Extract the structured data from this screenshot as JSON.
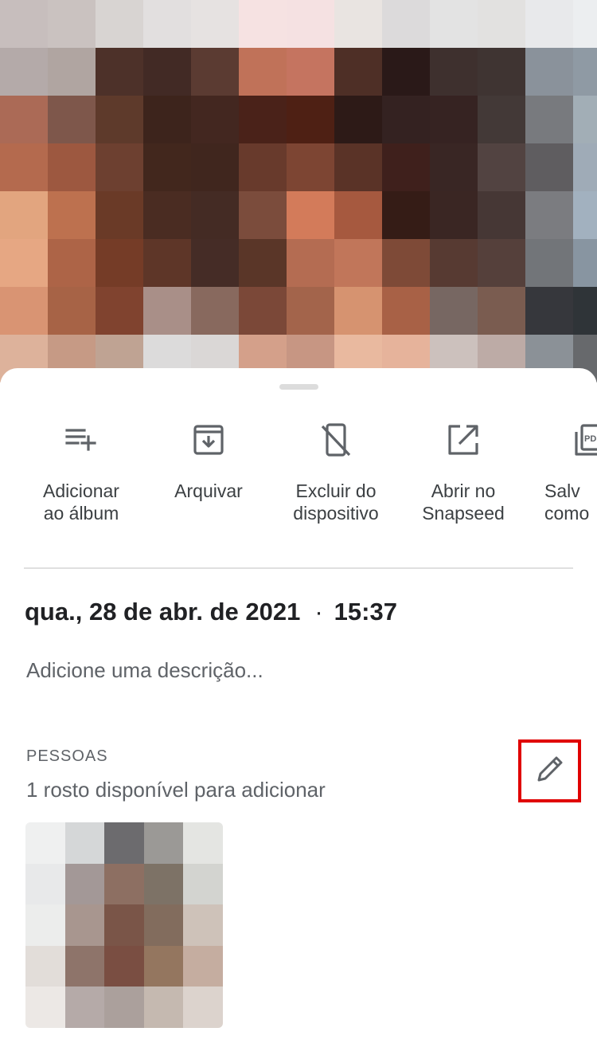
{
  "actions": [
    {
      "label": "Adicionar\nao álbum",
      "icon": "add-to-album-icon"
    },
    {
      "label": "Arquivar",
      "icon": "archive-icon"
    },
    {
      "label": "Excluir do\ndispositivo",
      "icon": "delete-from-device-icon"
    },
    {
      "label": "Abrir no\nSnapseed",
      "icon": "open-in-snapseed-icon"
    },
    {
      "label": "Salv\ncomo",
      "icon": "save-as-pdf-icon",
      "icon_text": "PDF"
    }
  ],
  "info": {
    "date": "qua., 28 de abr. de 2021",
    "separator": "·",
    "time": "15:37",
    "description_placeholder": "Adicione uma descrição..."
  },
  "people": {
    "title": "PESSOAS",
    "subtitle": "1 rosto disponível para adicionar",
    "edit_icon": "pencil-icon"
  },
  "photo": {
    "icon": "pixelated-photo",
    "colors": [
      [
        "#c7bebd",
        "#cac2c0",
        "#d8d4d2",
        "#e2dfdf",
        "#e6e2e1",
        "#f6e2e2",
        "#f5e1e2",
        "#e9e4e1",
        "#dcdadb",
        "#e3e3e3",
        "#e2e1e0",
        "#e8e9eb",
        "#eceef0"
      ],
      [
        "#b4aaa9",
        "#b0a5a1",
        "#4d3129",
        "#422a25",
        "#5b3b32",
        "#c07259",
        "#c57460",
        "#4e2f26",
        "#2a1918",
        "#3e302e",
        "#3f3432",
        "#8a929b",
        "#8f9aa4"
      ],
      [
        "#ab6a56",
        "#7e574b",
        "#5e3a2b",
        "#3d241c",
        "#432720",
        "#4a2219",
        "#4e2014",
        "#2d1a17",
        "#342221",
        "#362322",
        "#433937",
        "#787a7e",
        "#a2aeb6"
      ],
      [
        "#b46a4e",
        "#9d5840",
        "#6d4030",
        "#42271d",
        "#40261e",
        "#683a2c",
        "#7d4533",
        "#5a3327",
        "#3f201c",
        "#392624",
        "#524341",
        "#5f5d60",
        "#9fabb7"
      ],
      [
        "#e2a57f",
        "#bd714f",
        "#6a3a27",
        "#4a2c22",
        "#442b24",
        "#7b4c3c",
        "#d37b5a",
        "#a6593f",
        "#351c16",
        "#3a2623",
        "#463735",
        "#7b7c80",
        "#a2b1bf"
      ],
      [
        "#e6a783",
        "#ad6447",
        "#753c27",
        "#5e3628",
        "#452c26",
        "#5a3628",
        "#b46c52",
        "#c1765a",
        "#7e4a37",
        "#573a32",
        "#55403b",
        "#727579",
        "#8895a1"
      ],
      [
        "#d99473",
        "#a76346",
        "#80432f",
        "#a98f88",
        "#88695e",
        "#7b4838",
        "#a3644b",
        "#d69370",
        "#a86146",
        "#776762",
        "#7a5c50",
        "#36373c",
        "#2f3438"
      ],
      [
        "#ddb29b",
        "#c69a85",
        "#bfa393",
        "#dcdbdb",
        "#dad7d6",
        "#d4a08a",
        "#c79683",
        "#e9b99f",
        "#e6b39b",
        "#ccc1bd",
        "#bdaba6",
        "#8b9197",
        "#67696c"
      ]
    ]
  },
  "face": {
    "icon": "pixelated-face-thumbnail",
    "colors": [
      [
        "#eff0f0",
        "#d5d7d8",
        "#6c6b6e",
        "#9b9996",
        "#e4e5e2"
      ],
      [
        "#e8e9ea",
        "#a39897",
        "#8d6f62",
        "#7d7266",
        "#d3d4d0"
      ],
      [
        "#ecedec",
        "#a8968f",
        "#7a5548",
        "#826c5d",
        "#cec2b9"
      ],
      [
        "#e2ddd9",
        "#8e746a",
        "#7a4e42",
        "#94765f",
        "#c5ada0"
      ],
      [
        "#ece8e5",
        "#b5aaa8",
        "#aba09c",
        "#c5b9b0",
        "#dcd3cd"
      ]
    ]
  }
}
